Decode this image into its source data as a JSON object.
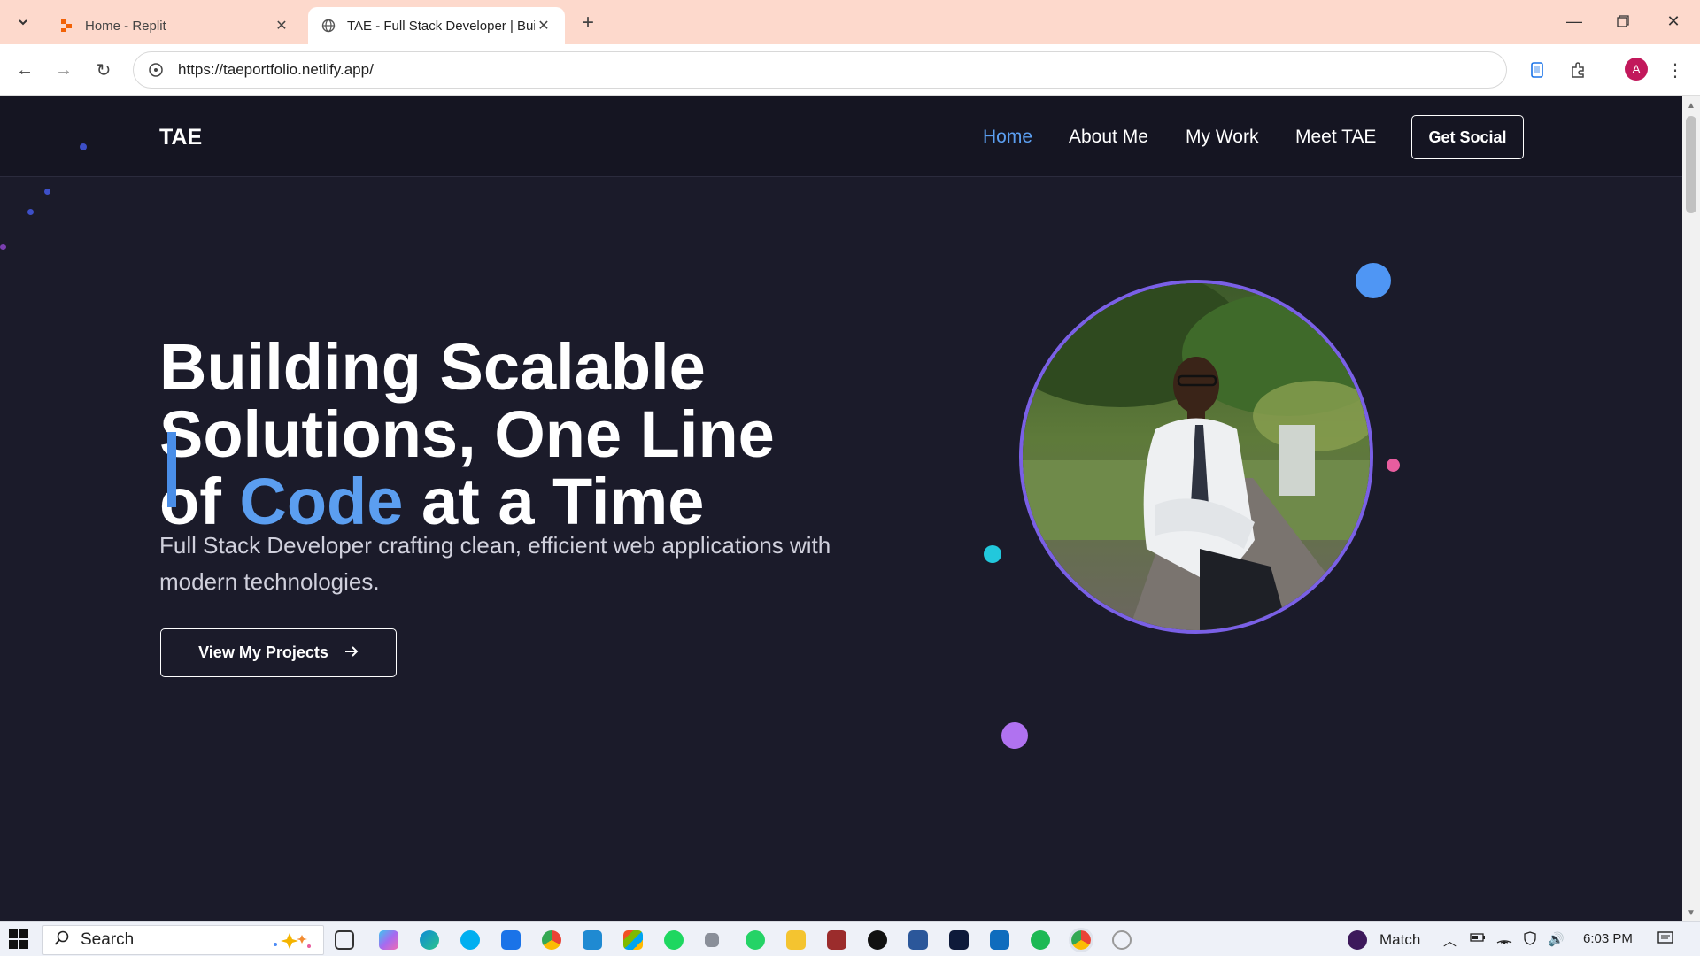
{
  "browser": {
    "tabs": [
      {
        "title": "Home - Replit",
        "active": false
      },
      {
        "title": "TAE - Full Stack Developer | Buil",
        "active": true
      }
    ],
    "url": "https://taeportfolio.netlify.app/",
    "profile_initial": "A"
  },
  "site": {
    "logo": "TAE",
    "nav": [
      {
        "label": "Home",
        "active": true
      },
      {
        "label": "About Me",
        "active": false
      },
      {
        "label": "My Work",
        "active": false
      },
      {
        "label": "Meet TAE",
        "active": false
      }
    ],
    "social_button": "Get Social",
    "hero": {
      "title_part1": "Building Scalable Solutions, One Line of ",
      "title_accent": "Code",
      "title_part2": " at a Time",
      "subtitle": "Full Stack Developer crafting clean, efficient web applications with modern technologies.",
      "cta": "View My Projects"
    },
    "colors": {
      "accent": "#5b9ef0",
      "background": "#1b1b2a",
      "ring": "#7a60e6"
    }
  },
  "taskbar": {
    "search_label": "Search",
    "weather_text": "Match",
    "clock": "6:03 PM"
  }
}
